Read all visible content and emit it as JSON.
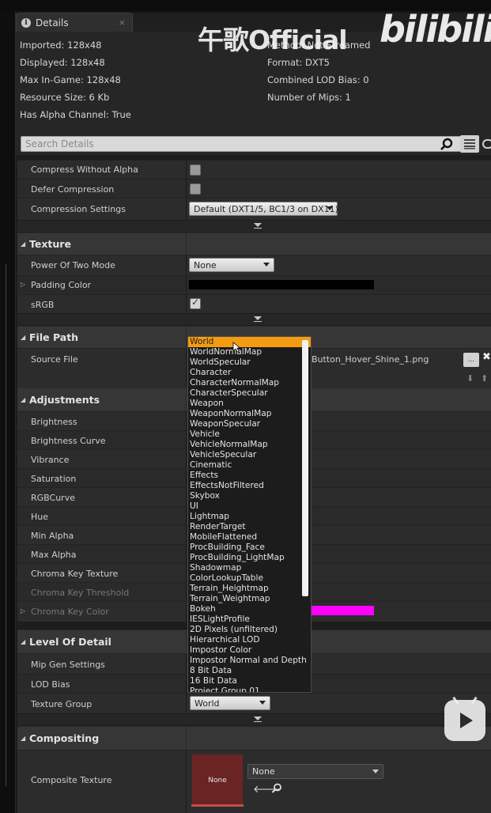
{
  "tab": {
    "title": "Details",
    "close": "×"
  },
  "watermark": {
    "text": "午歌Official",
    "logo": "bilibili"
  },
  "info": {
    "imported": "Imported: 128x48",
    "displayed": "Displayed: 128x48",
    "max_ingame": "Max In-Game: 128x48",
    "resource_size": "Resource Size: 6 Kb",
    "has_alpha": "Has Alpha Channel: True",
    "method": "Method: Not Streamed",
    "format": "Format: DXT5",
    "lod_bias": "Combined LOD Bias: 0",
    "mips": "Number of Mips: 1"
  },
  "search": {
    "placeholder": "Search Details"
  },
  "compression": {
    "compress_without_alpha": "Compress Without Alpha",
    "defer_compression": "Defer Compression",
    "compression_settings": "Compression Settings",
    "compression_settings_value": "Default (DXT1/5, BC1/3 on DX11)"
  },
  "texture": {
    "title": "Texture",
    "power_of_two": "Power Of Two Mode",
    "power_of_two_value": "None",
    "padding_color": "Padding Color",
    "srgb": "sRGB"
  },
  "file_path": {
    "title": "File Path",
    "source_file": "Source File",
    "source_file_value": "Button_Hover_Shine_1.png",
    "browse": "..."
  },
  "adjustments": {
    "title": "Adjustments",
    "brightness": "Brightness",
    "brightness_curve": "Brightness Curve",
    "vibrance": "Vibrance",
    "saturation": "Saturation",
    "rgb_curve": "RGBCurve",
    "hue": "Hue",
    "min_alpha": "Min Alpha",
    "max_alpha": "Max Alpha",
    "chroma_key_texture": "Chroma Key Texture",
    "chroma_key_threshold": "Chroma Key Threshold",
    "chroma_key_color": "Chroma Key Color"
  },
  "lod": {
    "title": "Level Of Detail",
    "mip_gen": "Mip Gen Settings",
    "lod_bias": "LOD Bias",
    "texture_group": "Texture Group",
    "texture_group_value": "World"
  },
  "compositing": {
    "title": "Compositing",
    "composite_texture": "Composite Texture",
    "thumb_label": "None",
    "asset_value": "None"
  },
  "texture_group_options": [
    "World",
    "WorldNormalMap",
    "WorldSpecular",
    "Character",
    "CharacterNormalMap",
    "CharacterSpecular",
    "Weapon",
    "WeaponNormalMap",
    "WeaponSpecular",
    "Vehicle",
    "VehicleNormalMap",
    "VehicleSpecular",
    "Cinematic",
    "Effects",
    "EffectsNotFiltered",
    "Skybox",
    "UI",
    "Lightmap",
    "RenderTarget",
    "MobileFlattened",
    "ProcBuilding_Face",
    "ProcBuilding_LightMap",
    "Shadowmap",
    "ColorLookupTable",
    "Terrain_Heightmap",
    "Terrain_Weightmap",
    "Bokeh",
    "IESLightProfile",
    "2D Pixels (unfiltered)",
    "Hierarchical LOD",
    "Impostor Color",
    "Impostor Normal and Depth",
    "8 Bit Data",
    "16 Bit Data",
    "Project Group 01"
  ],
  "selected_option_index": 0,
  "colors": {
    "padding_color": "#000000",
    "chroma_key_color": "#ff00ff",
    "highlight": "#f39c12"
  }
}
